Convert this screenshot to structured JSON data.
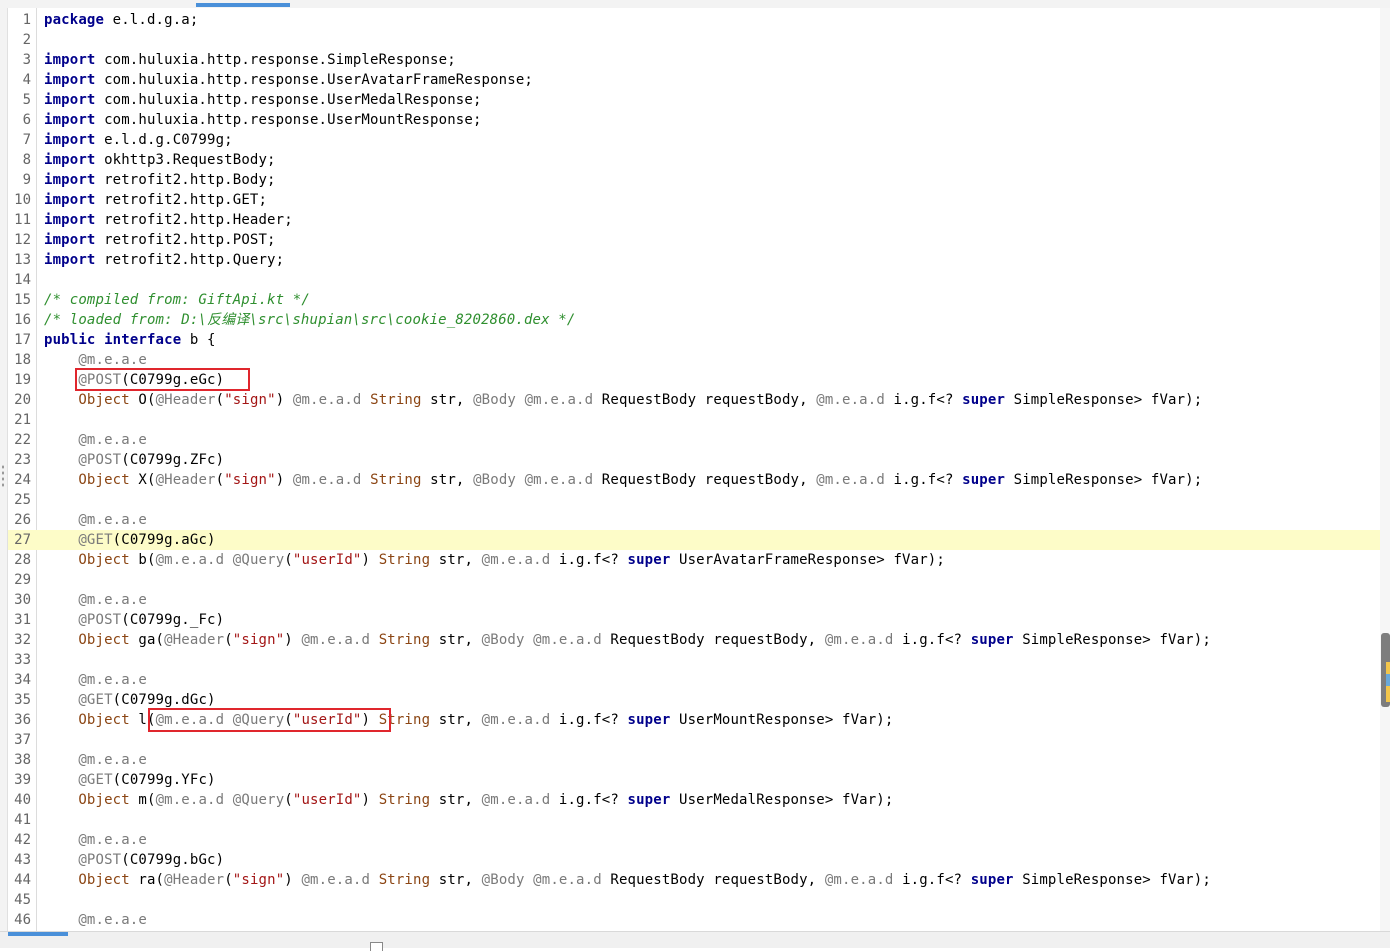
{
  "colors": {
    "keyword": "#00008b",
    "comment": "#2f8f2f",
    "annotation": "#7a7a7a",
    "string": "#a31515",
    "type": "#8b4513",
    "highlight_line": "#fdfcc8",
    "annotation_box": "#e0262d"
  },
  "editor": {
    "highlighted_line": 27,
    "lines": [
      {
        "n": "1",
        "t": [
          [
            "kw",
            "package"
          ],
          [
            "p",
            " e.l.d.g.a;"
          ]
        ]
      },
      {
        "n": "2",
        "t": []
      },
      {
        "n": "3",
        "t": [
          [
            "kw",
            "import"
          ],
          [
            "p",
            " com.huluxia.http.response.SimpleResponse;"
          ]
        ]
      },
      {
        "n": "4",
        "t": [
          [
            "kw",
            "import"
          ],
          [
            "p",
            " com.huluxia.http.response.UserAvatarFrameResponse;"
          ]
        ]
      },
      {
        "n": "5",
        "t": [
          [
            "kw",
            "import"
          ],
          [
            "p",
            " com.huluxia.http.response.UserMedalResponse;"
          ]
        ]
      },
      {
        "n": "6",
        "t": [
          [
            "kw",
            "import"
          ],
          [
            "p",
            " com.huluxia.http.response.UserMountResponse;"
          ]
        ]
      },
      {
        "n": "7",
        "t": [
          [
            "kw",
            "import"
          ],
          [
            "p",
            " e.l.d.g.C0799g;"
          ]
        ]
      },
      {
        "n": "8",
        "t": [
          [
            "kw",
            "import"
          ],
          [
            "p",
            " okhttp3.RequestBody;"
          ]
        ]
      },
      {
        "n": "9",
        "t": [
          [
            "kw",
            "import"
          ],
          [
            "p",
            " retrofit2.http.Body;"
          ]
        ]
      },
      {
        "n": "10",
        "t": [
          [
            "kw",
            "import"
          ],
          [
            "p",
            " retrofit2.http.GET;"
          ]
        ]
      },
      {
        "n": "11",
        "t": [
          [
            "kw",
            "import"
          ],
          [
            "p",
            " retrofit2.http.Header;"
          ]
        ]
      },
      {
        "n": "12",
        "t": [
          [
            "kw",
            "import"
          ],
          [
            "p",
            " retrofit2.http.POST;"
          ]
        ]
      },
      {
        "n": "13",
        "t": [
          [
            "kw",
            "import"
          ],
          [
            "p",
            " retrofit2.http.Query;"
          ]
        ]
      },
      {
        "n": "14",
        "t": []
      },
      {
        "n": "15",
        "t": [
          [
            "cm",
            "/* compiled from: GiftApi.kt */"
          ]
        ]
      },
      {
        "n": "16",
        "t": [
          [
            "cm",
            "/* loaded from: D:\\反编译\\src\\shupian\\src\\cookie_8202860.dex */"
          ]
        ]
      },
      {
        "n": "17",
        "t": [
          [
            "kw",
            "public"
          ],
          [
            "p",
            " "
          ],
          [
            "kw",
            "interface"
          ],
          [
            "p",
            " b {"
          ]
        ]
      },
      {
        "n": "18",
        "t": [
          [
            "p",
            "    "
          ],
          [
            "an",
            "@m.e.a.e"
          ]
        ]
      },
      {
        "n": "19",
        "t": [
          [
            "p",
            "    "
          ],
          [
            "an",
            "@POST"
          ],
          [
            "p",
            "(C0799g.eGc)"
          ]
        ]
      },
      {
        "n": "20",
        "t": [
          [
            "p",
            "    "
          ],
          [
            "ty",
            "Object"
          ],
          [
            "p",
            " O("
          ],
          [
            "an",
            "@Header"
          ],
          [
            "p",
            "("
          ],
          [
            "st",
            "\"sign\""
          ],
          [
            "p",
            ") "
          ],
          [
            "an",
            "@m.e.a.d"
          ],
          [
            "p",
            " "
          ],
          [
            "ty",
            "String"
          ],
          [
            "p",
            " str, "
          ],
          [
            "an",
            "@Body"
          ],
          [
            "p",
            " "
          ],
          [
            "an",
            "@m.e.a.d"
          ],
          [
            "p",
            " RequestBody requestBody, "
          ],
          [
            "an",
            "@m.e.a.d"
          ],
          [
            "p",
            " i.g.f<? "
          ],
          [
            "kw",
            "super"
          ],
          [
            "p",
            " SimpleResponse> fVar);"
          ]
        ]
      },
      {
        "n": "21",
        "t": []
      },
      {
        "n": "22",
        "t": [
          [
            "p",
            "    "
          ],
          [
            "an",
            "@m.e.a.e"
          ]
        ]
      },
      {
        "n": "23",
        "t": [
          [
            "p",
            "    "
          ],
          [
            "an",
            "@POST"
          ],
          [
            "p",
            "(C0799g.ZFc)"
          ]
        ]
      },
      {
        "n": "24",
        "t": [
          [
            "p",
            "    "
          ],
          [
            "ty",
            "Object"
          ],
          [
            "p",
            " X("
          ],
          [
            "an",
            "@Header"
          ],
          [
            "p",
            "("
          ],
          [
            "st",
            "\"sign\""
          ],
          [
            "p",
            ") "
          ],
          [
            "an",
            "@m.e.a.d"
          ],
          [
            "p",
            " "
          ],
          [
            "ty",
            "String"
          ],
          [
            "p",
            " str, "
          ],
          [
            "an",
            "@Body"
          ],
          [
            "p",
            " "
          ],
          [
            "an",
            "@m.e.a.d"
          ],
          [
            "p",
            " RequestBody requestBody, "
          ],
          [
            "an",
            "@m.e.a.d"
          ],
          [
            "p",
            " i.g.f<? "
          ],
          [
            "kw",
            "super"
          ],
          [
            "p",
            " SimpleResponse> fVar);"
          ]
        ]
      },
      {
        "n": "25",
        "t": []
      },
      {
        "n": "26",
        "t": [
          [
            "p",
            "    "
          ],
          [
            "an",
            "@m.e.a.e"
          ]
        ]
      },
      {
        "n": "27",
        "t": [
          [
            "p",
            "    "
          ],
          [
            "an",
            "@GET"
          ],
          [
            "p",
            "(C0799g.aGc)"
          ]
        ]
      },
      {
        "n": "28",
        "t": [
          [
            "p",
            "    "
          ],
          [
            "ty",
            "Object"
          ],
          [
            "p",
            " b("
          ],
          [
            "an",
            "@m.e.a.d"
          ],
          [
            "p",
            " "
          ],
          [
            "an",
            "@Query"
          ],
          [
            "p",
            "("
          ],
          [
            "st",
            "\"userId\""
          ],
          [
            "p",
            ") "
          ],
          [
            "ty",
            "String"
          ],
          [
            "p",
            " str, "
          ],
          [
            "an",
            "@m.e.a.d"
          ],
          [
            "p",
            " i.g.f<? "
          ],
          [
            "kw",
            "super"
          ],
          [
            "p",
            " UserAvatarFrameResponse> fVar);"
          ]
        ]
      },
      {
        "n": "29",
        "t": []
      },
      {
        "n": "30",
        "t": [
          [
            "p",
            "    "
          ],
          [
            "an",
            "@m.e.a.e"
          ]
        ]
      },
      {
        "n": "31",
        "t": [
          [
            "p",
            "    "
          ],
          [
            "an",
            "@POST"
          ],
          [
            "p",
            "(C0799g._Fc)"
          ]
        ]
      },
      {
        "n": "32",
        "t": [
          [
            "p",
            "    "
          ],
          [
            "ty",
            "Object"
          ],
          [
            "p",
            " ga("
          ],
          [
            "an",
            "@Header"
          ],
          [
            "p",
            "("
          ],
          [
            "st",
            "\"sign\""
          ],
          [
            "p",
            ") "
          ],
          [
            "an",
            "@m.e.a.d"
          ],
          [
            "p",
            " "
          ],
          [
            "ty",
            "String"
          ],
          [
            "p",
            " str, "
          ],
          [
            "an",
            "@Body"
          ],
          [
            "p",
            " "
          ],
          [
            "an",
            "@m.e.a.d"
          ],
          [
            "p",
            " RequestBody requestBody, "
          ],
          [
            "an",
            "@m.e.a.d"
          ],
          [
            "p",
            " i.g.f<? "
          ],
          [
            "kw",
            "super"
          ],
          [
            "p",
            " SimpleResponse> fVar);"
          ]
        ]
      },
      {
        "n": "33",
        "t": []
      },
      {
        "n": "34",
        "t": [
          [
            "p",
            "    "
          ],
          [
            "an",
            "@m.e.a.e"
          ]
        ]
      },
      {
        "n": "35",
        "t": [
          [
            "p",
            "    "
          ],
          [
            "an",
            "@GET"
          ],
          [
            "p",
            "(C0799g.dGc)"
          ]
        ]
      },
      {
        "n": "36",
        "t": [
          [
            "p",
            "    "
          ],
          [
            "ty",
            "Object"
          ],
          [
            "p",
            " l("
          ],
          [
            "an",
            "@m.e.a.d"
          ],
          [
            "p",
            " "
          ],
          [
            "an",
            "@Query"
          ],
          [
            "p",
            "("
          ],
          [
            "st",
            "\"userId\""
          ],
          [
            "p",
            ") "
          ],
          [
            "ty",
            "String"
          ],
          [
            "p",
            " str, "
          ],
          [
            "an",
            "@m.e.a.d"
          ],
          [
            "p",
            " i.g.f<? "
          ],
          [
            "kw",
            "super"
          ],
          [
            "p",
            " UserMountResponse> fVar);"
          ]
        ]
      },
      {
        "n": "37",
        "t": []
      },
      {
        "n": "38",
        "t": [
          [
            "p",
            "    "
          ],
          [
            "an",
            "@m.e.a.e"
          ]
        ]
      },
      {
        "n": "39",
        "t": [
          [
            "p",
            "    "
          ],
          [
            "an",
            "@GET"
          ],
          [
            "p",
            "(C0799g.YFc)"
          ]
        ]
      },
      {
        "n": "40",
        "t": [
          [
            "p",
            "    "
          ],
          [
            "ty",
            "Object"
          ],
          [
            "p",
            " m("
          ],
          [
            "an",
            "@m.e.a.d"
          ],
          [
            "p",
            " "
          ],
          [
            "an",
            "@Query"
          ],
          [
            "p",
            "("
          ],
          [
            "st",
            "\"userId\""
          ],
          [
            "p",
            ") "
          ],
          [
            "ty",
            "String"
          ],
          [
            "p",
            " str, "
          ],
          [
            "an",
            "@m.e.a.d"
          ],
          [
            "p",
            " i.g.f<? "
          ],
          [
            "kw",
            "super"
          ],
          [
            "p",
            " UserMedalResponse> fVar);"
          ]
        ]
      },
      {
        "n": "41",
        "t": []
      },
      {
        "n": "42",
        "t": [
          [
            "p",
            "    "
          ],
          [
            "an",
            "@m.e.a.e"
          ]
        ]
      },
      {
        "n": "43",
        "t": [
          [
            "p",
            "    "
          ],
          [
            "an",
            "@POST"
          ],
          [
            "p",
            "(C0799g.bGc)"
          ]
        ]
      },
      {
        "n": "44",
        "t": [
          [
            "p",
            "    "
          ],
          [
            "ty",
            "Object"
          ],
          [
            "p",
            " ra("
          ],
          [
            "an",
            "@Header"
          ],
          [
            "p",
            "("
          ],
          [
            "st",
            "\"sign\""
          ],
          [
            "p",
            ") "
          ],
          [
            "an",
            "@m.e.a.d"
          ],
          [
            "p",
            " "
          ],
          [
            "ty",
            "String"
          ],
          [
            "p",
            " str, "
          ],
          [
            "an",
            "@Body"
          ],
          [
            "p",
            " "
          ],
          [
            "an",
            "@m.e.a.d"
          ],
          [
            "p",
            " RequestBody requestBody, "
          ],
          [
            "an",
            "@m.e.a.d"
          ],
          [
            "p",
            " i.g.f<? "
          ],
          [
            "kw",
            "super"
          ],
          [
            "p",
            " SimpleResponse> fVar);"
          ]
        ]
      },
      {
        "n": "45",
        "t": []
      },
      {
        "n": "46",
        "t": [
          [
            "p",
            "    "
          ],
          [
            "an",
            "@m.e.a.e"
          ]
        ]
      }
    ]
  },
  "statusbar": {
    "left_text": "",
    "checkbox_label": ""
  },
  "icons": {
    "splitter": "drag-grip-icon",
    "scrollbar": "vertical-scrollbar"
  }
}
